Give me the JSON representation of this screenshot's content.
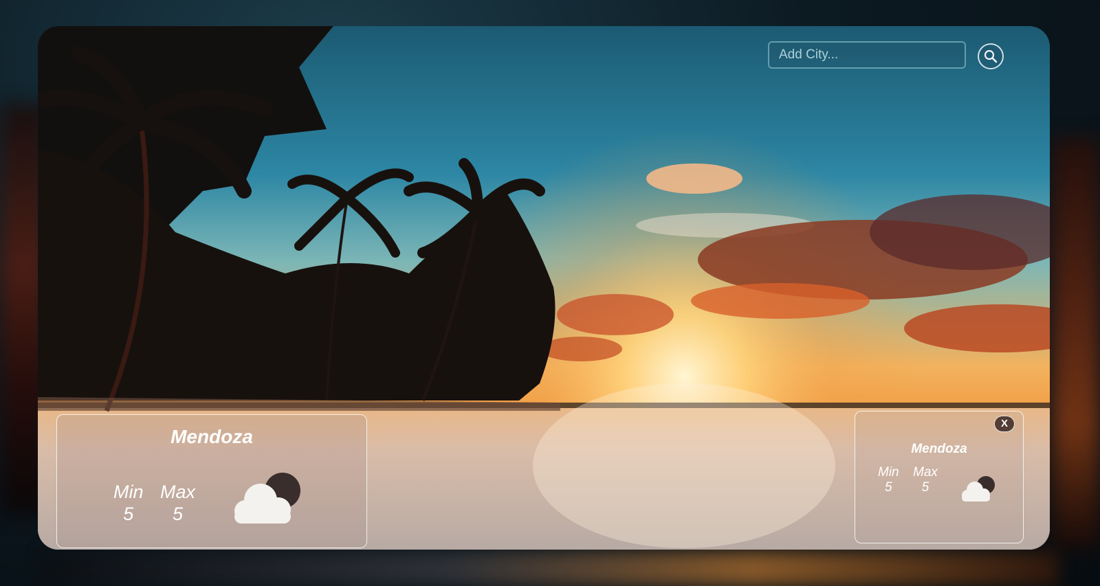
{
  "search": {
    "placeholder": "Add City..."
  },
  "main_card": {
    "city": "Mendoza",
    "min_label": "Min",
    "max_label": "Max",
    "min_value": "5",
    "max_value": "5",
    "icon": "cloud-night-icon"
  },
  "side_card": {
    "city": "Mendoza",
    "min_label": "Min",
    "max_label": "Max",
    "min_value": "5",
    "max_value": "5",
    "icon": "cloud-night-icon",
    "close_label": "X"
  },
  "colors": {
    "accent": "#2c86a4",
    "sunset": "#f2a24a",
    "card_border": "#ffffff"
  }
}
